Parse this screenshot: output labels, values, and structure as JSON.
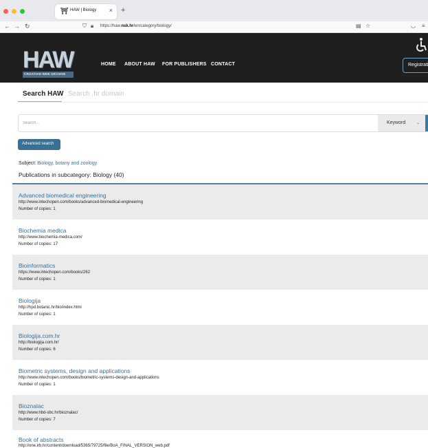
{
  "browser": {
    "tab_title": "HAW | Biology",
    "url_prefix": "https://haw.",
    "url_domain": "nsk.hr",
    "url_path": "/en/category/biology/",
    "traffic_colors": [
      "#ff5f57",
      "#febc2e",
      "#28c840"
    ]
  },
  "header": {
    "logo_letters": "HAW",
    "logo_subtitle": "CROATIAN WEB ARCHIVE",
    "menu": [
      "HOME",
      "ABOUT HAW",
      "FOR PUBLISHERS",
      "CONTACT"
    ],
    "registration_label": "Registrati"
  },
  "search": {
    "tab_active": "Search HAW",
    "tab_inactive": "Search .hr domain",
    "placeholder": "Search...",
    "select_value": "Keyword",
    "advanced_label": "Advanced search"
  },
  "category": {
    "subject_label": "Subject: ",
    "subject_value": "Biology, botany and zoology",
    "publications": "Publications in subcategory: Biology (40)"
  },
  "results": [
    {
      "title": "Advanced biomedical engineering",
      "url": "http://www.intechopen.com/books/advanced-biomedical-engineering",
      "copies": "Number of copies: 1"
    },
    {
      "title": "Biochemia medica",
      "url": "http://www.biochemia-medica.com/",
      "copies": "Number of copies: 17"
    },
    {
      "title": "Bioinformatics",
      "url": "https://www.intechopen.com/books/262",
      "copies": "Number of copies: 1"
    },
    {
      "title": "Biologija",
      "url": "http://hpd.botanic.hr/bio/index.html",
      "copies": "Number of copies: 1"
    },
    {
      "title": "Biologija.com.hr",
      "url": "http://biologija.com.hr/",
      "copies": "Number of copies: 6"
    },
    {
      "title": "Biometric systems, design and applications",
      "url": "http://www.intechopen.com/books/biometric-systems-design-and-applications",
      "copies": "Number of copies: 1"
    },
    {
      "title": "Bioznalac",
      "url": "http://www.hbd-sbc.hr/bioznalac/",
      "copies": "Number of copies: 7"
    },
    {
      "title": "Book of abstracts",
      "url": "http://one.irb.hr/content/download/5365/79725/file/BoA_FINAL_VERSION_web.pdf",
      "copies": ""
    }
  ]
}
